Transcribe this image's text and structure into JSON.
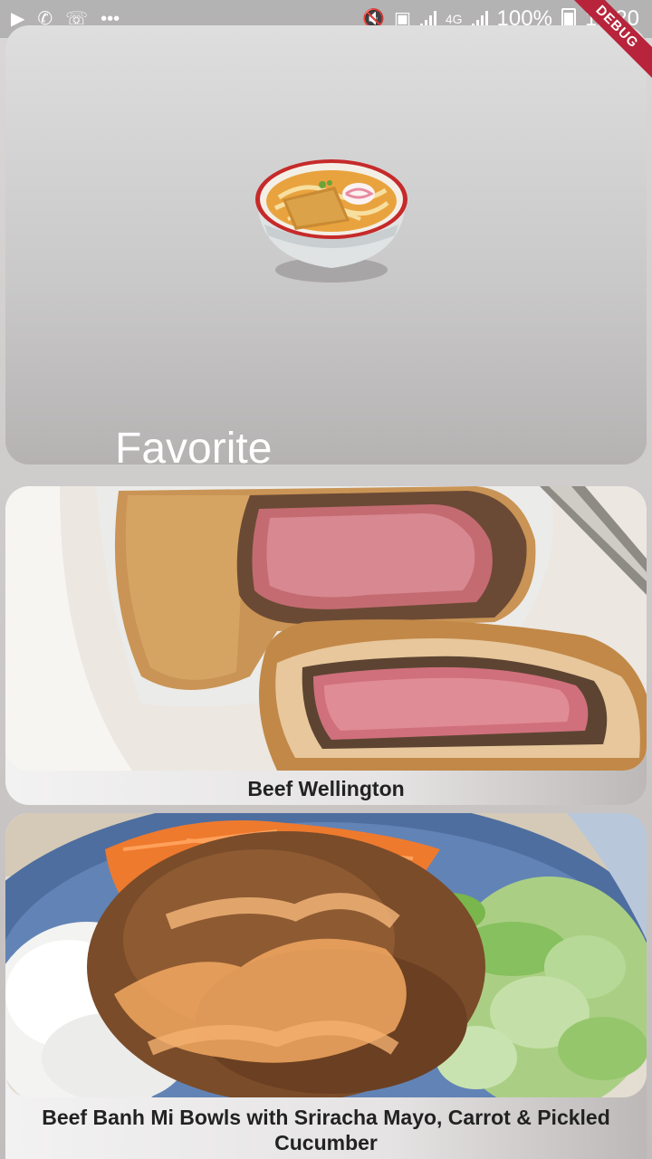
{
  "status_bar": {
    "left_icons": [
      "play-icon",
      "whatsapp-icon",
      "phone-icon",
      "more-icon"
    ],
    "network": "4G",
    "battery": "100%",
    "time": "12:20"
  },
  "debug_banner": "DEBUG",
  "favorite_card": {
    "label": "Favorite",
    "icon": "noodle-bowl-icon"
  },
  "recipes": [
    {
      "title": "Beef Wellington",
      "image": "beef-wellington-photo"
    },
    {
      "title": "Beef Banh Mi Bowls with Sriracha Mayo, Carrot & Pickled Cucumber",
      "image": "banh-mi-bowl-photo"
    }
  ]
}
